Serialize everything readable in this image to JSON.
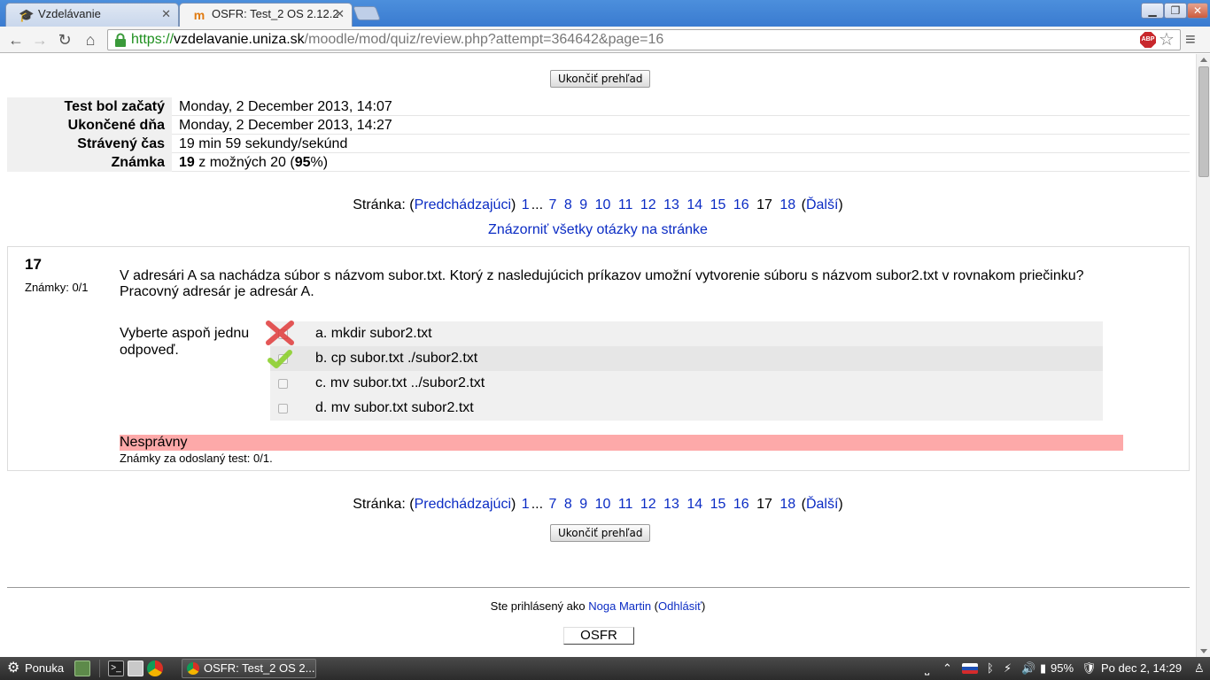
{
  "browser": {
    "tabs": [
      {
        "title": "Vzdelávanie",
        "icon": "graduation-cap-icon",
        "active": false
      },
      {
        "title": "OSFR: Test_2 OS 2.12.2",
        "icon": "moodle-icon",
        "active": true
      }
    ],
    "url": {
      "scheme": "https://",
      "host": "vzdelavanie.uniza.sk",
      "path": "/moodle/mod/quiz/review.php?attempt=364642&page=16"
    },
    "abp_label": "ABP"
  },
  "page": {
    "finish_review_label": "Ukončiť prehľad",
    "summary": [
      {
        "label": "Test bol začatý",
        "value": "Monday, 2 December 2013, 14:07"
      },
      {
        "label": "Ukončené dňa",
        "value": "Monday, 2 December 2013, 14:27"
      },
      {
        "label": "Strávený čas",
        "value": "19 min 59 sekundy/sekúnd"
      }
    ],
    "grade": {
      "label": "Známka",
      "score": "19",
      "middle": " z možných 20 (",
      "percent": "95",
      "suffix": "%)"
    },
    "paging": {
      "label": "Stránka:",
      "prev": "Predchádzajúci",
      "next": "Ďalší",
      "first": "1",
      "ellipsis": "...",
      "pages": [
        "7",
        "8",
        "9",
        "10",
        "11",
        "12",
        "13",
        "14",
        "15",
        "16"
      ],
      "current": "17",
      "last": "18"
    },
    "show_all": "Znázorniť všetky otázky na stránke",
    "question": {
      "number": "17",
      "marks": "Známky: 0/1",
      "text": "V adresári A sa nachádza súbor s názvom subor.txt. Ktorý z nasledujúcich príkazov umožní vytvorenie súboru s názvom subor2.txt v rovnakom priečinku? Pracovný adresár je adresár A.",
      "prompt": "Vyberte aspoň jednu odpoveď.",
      "answers": [
        {
          "text": "a. mkdir subor2.txt",
          "checked": true,
          "mark": "incorrect"
        },
        {
          "text": "b. cp subor.txt ./subor2.txt",
          "checked": true,
          "mark": "correct"
        },
        {
          "text": "c. mv subor.txt ../subor2.txt",
          "checked": false,
          "mark": ""
        },
        {
          "text": "d. mv subor.txt subor2.txt",
          "checked": false,
          "mark": ""
        }
      ],
      "state": "Nesprávny",
      "state_color": "#fda9a9",
      "submitted_marks": "Známky za odoslaný test: 0/1."
    },
    "footer": {
      "logged_in_prefix": "Ste prihlásený ako",
      "user": "Noga Martin",
      "logout": "Odhlásiť",
      "course_link": "OSFR"
    }
  },
  "taskbar": {
    "menu_label": "Ponuka",
    "window_title": "OSFR: Test_2 OS 2....",
    "battery": "95%",
    "clock": "Po dec  2, 14:29"
  }
}
